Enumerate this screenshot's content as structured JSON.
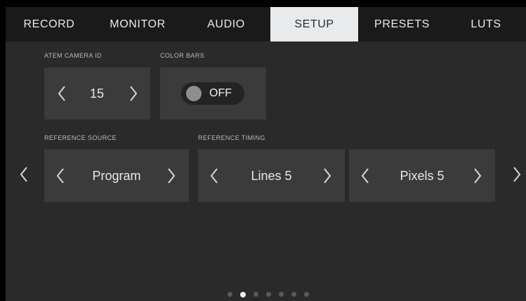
{
  "tabs": [
    {
      "label": "RECORD"
    },
    {
      "label": "MONITOR"
    },
    {
      "label": "AUDIO"
    },
    {
      "label": "SETUP",
      "active": true
    },
    {
      "label": "PRESETS"
    },
    {
      "label": "LUTS"
    }
  ],
  "camera_id": {
    "label": "ATEM CAMERA ID",
    "value": "15"
  },
  "color_bars": {
    "label": "COLOR BARS",
    "state": "OFF"
  },
  "reference_source": {
    "label": "REFERENCE SOURCE",
    "value": "Program"
  },
  "reference_timing": {
    "label": "REFERENCE TIMING",
    "lines": "Lines 5",
    "pixels": "Pixels 5"
  },
  "pagination": {
    "total": 7,
    "active_index": 1
  },
  "icons": {
    "prev": "chevron-left-icon",
    "next": "chevron-right-icon"
  },
  "colors": {
    "active_tab": "#e9eaeb",
    "background": "#2a2a2a",
    "tile": "#3b3b3b"
  }
}
